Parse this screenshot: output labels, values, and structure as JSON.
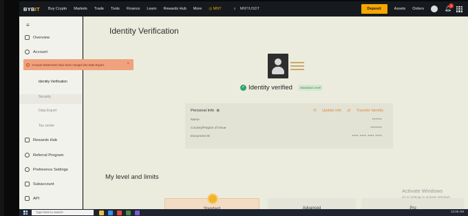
{
  "nav": {
    "logo": "BYB",
    "logo_accent": "IT",
    "items": [
      "Buy Crypto",
      "Markets",
      "Trade",
      "Tools",
      "Finance",
      "Learn",
      "Rewards Hub",
      "More"
    ],
    "mnt": "MNT",
    "pair": "MNT/USDT",
    "deposit": "Deposit",
    "assets": "Assets",
    "orders": "Orders",
    "notification_count": "3"
  },
  "notice": {
    "text": "Account Statements have been merged into Data Export."
  },
  "sidebar": {
    "overview": "Overview",
    "account": "Account",
    "sub": [
      "Identity Verification",
      "Security",
      "Data Export",
      "Tax center"
    ],
    "rewards": "Rewards Hub",
    "referral": "Referral Program",
    "preference": "Preference Settings",
    "subaccount": "Subaccount",
    "api": "API"
  },
  "main": {
    "title": "Identity Verification",
    "verified_text": "Identity verified",
    "level_tag": "Standard Level",
    "personal_info": "Personal Info",
    "update_info": "Update info",
    "transfer_identity": "Transfer identity",
    "rows": [
      {
        "label": "Name",
        "value": "******"
      },
      {
        "label": "Country/Region of Issue",
        "value": "*******"
      },
      {
        "label": "Document ID",
        "value": "**** **** **** ****"
      }
    ],
    "limits_title": "My level and limits",
    "levels": [
      "Standard",
      "Advanced",
      "Pro"
    ]
  },
  "watermark": {
    "title": "Activate Windows",
    "sub": "Go to Settings to activate Windows."
  },
  "taskbar": {
    "search_placeholder": "Type here to search",
    "time": "12:05 AM"
  },
  "colors": {
    "accent": "#f7a600",
    "success": "#2fa36b",
    "notice_bg": "#f0a27e"
  }
}
